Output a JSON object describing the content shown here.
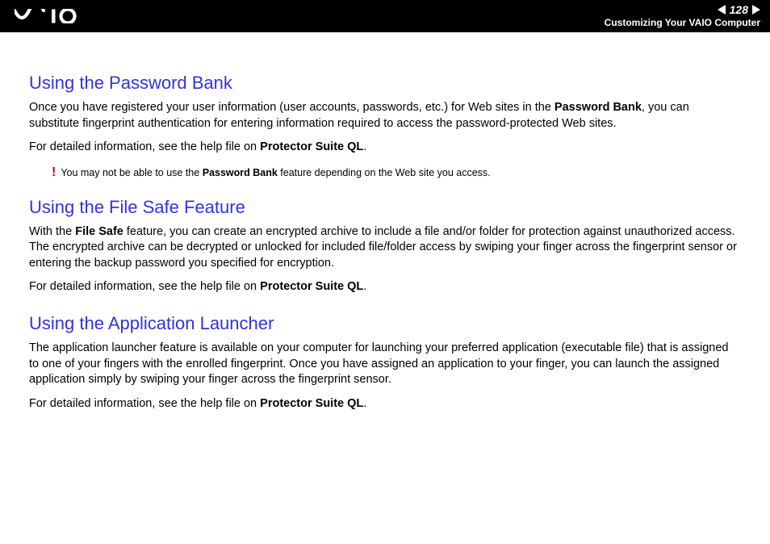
{
  "header": {
    "page_number": "128",
    "section_label": "Customizing Your VAIO Computer"
  },
  "sections": [
    {
      "heading": "Using the Password Bank",
      "paragraphs": [
        {
          "pre": "Once you have registered your user information (user accounts, passwords, etc.) for Web sites in the ",
          "bold1": "Password Bank",
          "post": ", you can substitute fingerprint authentication for entering information required to access the password-protected Web sites."
        },
        {
          "pre": "For detailed information, see the help file on ",
          "bold1": "Protector Suite QL",
          "post": "."
        }
      ],
      "note": {
        "icon": "!",
        "pre": "You may not be able to use the ",
        "bold": "Password Bank",
        "post": " feature depending on the Web site you access."
      }
    },
    {
      "heading": "Using the File Safe Feature",
      "paragraphs": [
        {
          "pre": "With the ",
          "bold1": "File Safe",
          "post": " feature, you can create an encrypted archive to include a file and/or folder for protection against unauthorized access. The encrypted archive can be decrypted or unlocked for included file/folder access by swiping your finger across the fingerprint sensor or entering the backup password you specified for encryption."
        },
        {
          "pre": "For detailed information, see the help file on ",
          "bold1": "Protector Suite QL",
          "post": "."
        }
      ]
    },
    {
      "heading": "Using the Application Launcher",
      "paragraphs": [
        {
          "pre": "The application launcher feature is available on your computer for launching your preferred application (executable file) that is assigned to one of your fingers with the enrolled fingerprint. Once you have assigned an application to your finger, you can launch the assigned application simply by swiping your finger across the fingerprint sensor.",
          "bold1": "",
          "post": ""
        },
        {
          "pre": "For detailed information, see the help file on ",
          "bold1": "Protector Suite QL",
          "post": "."
        }
      ]
    }
  ]
}
